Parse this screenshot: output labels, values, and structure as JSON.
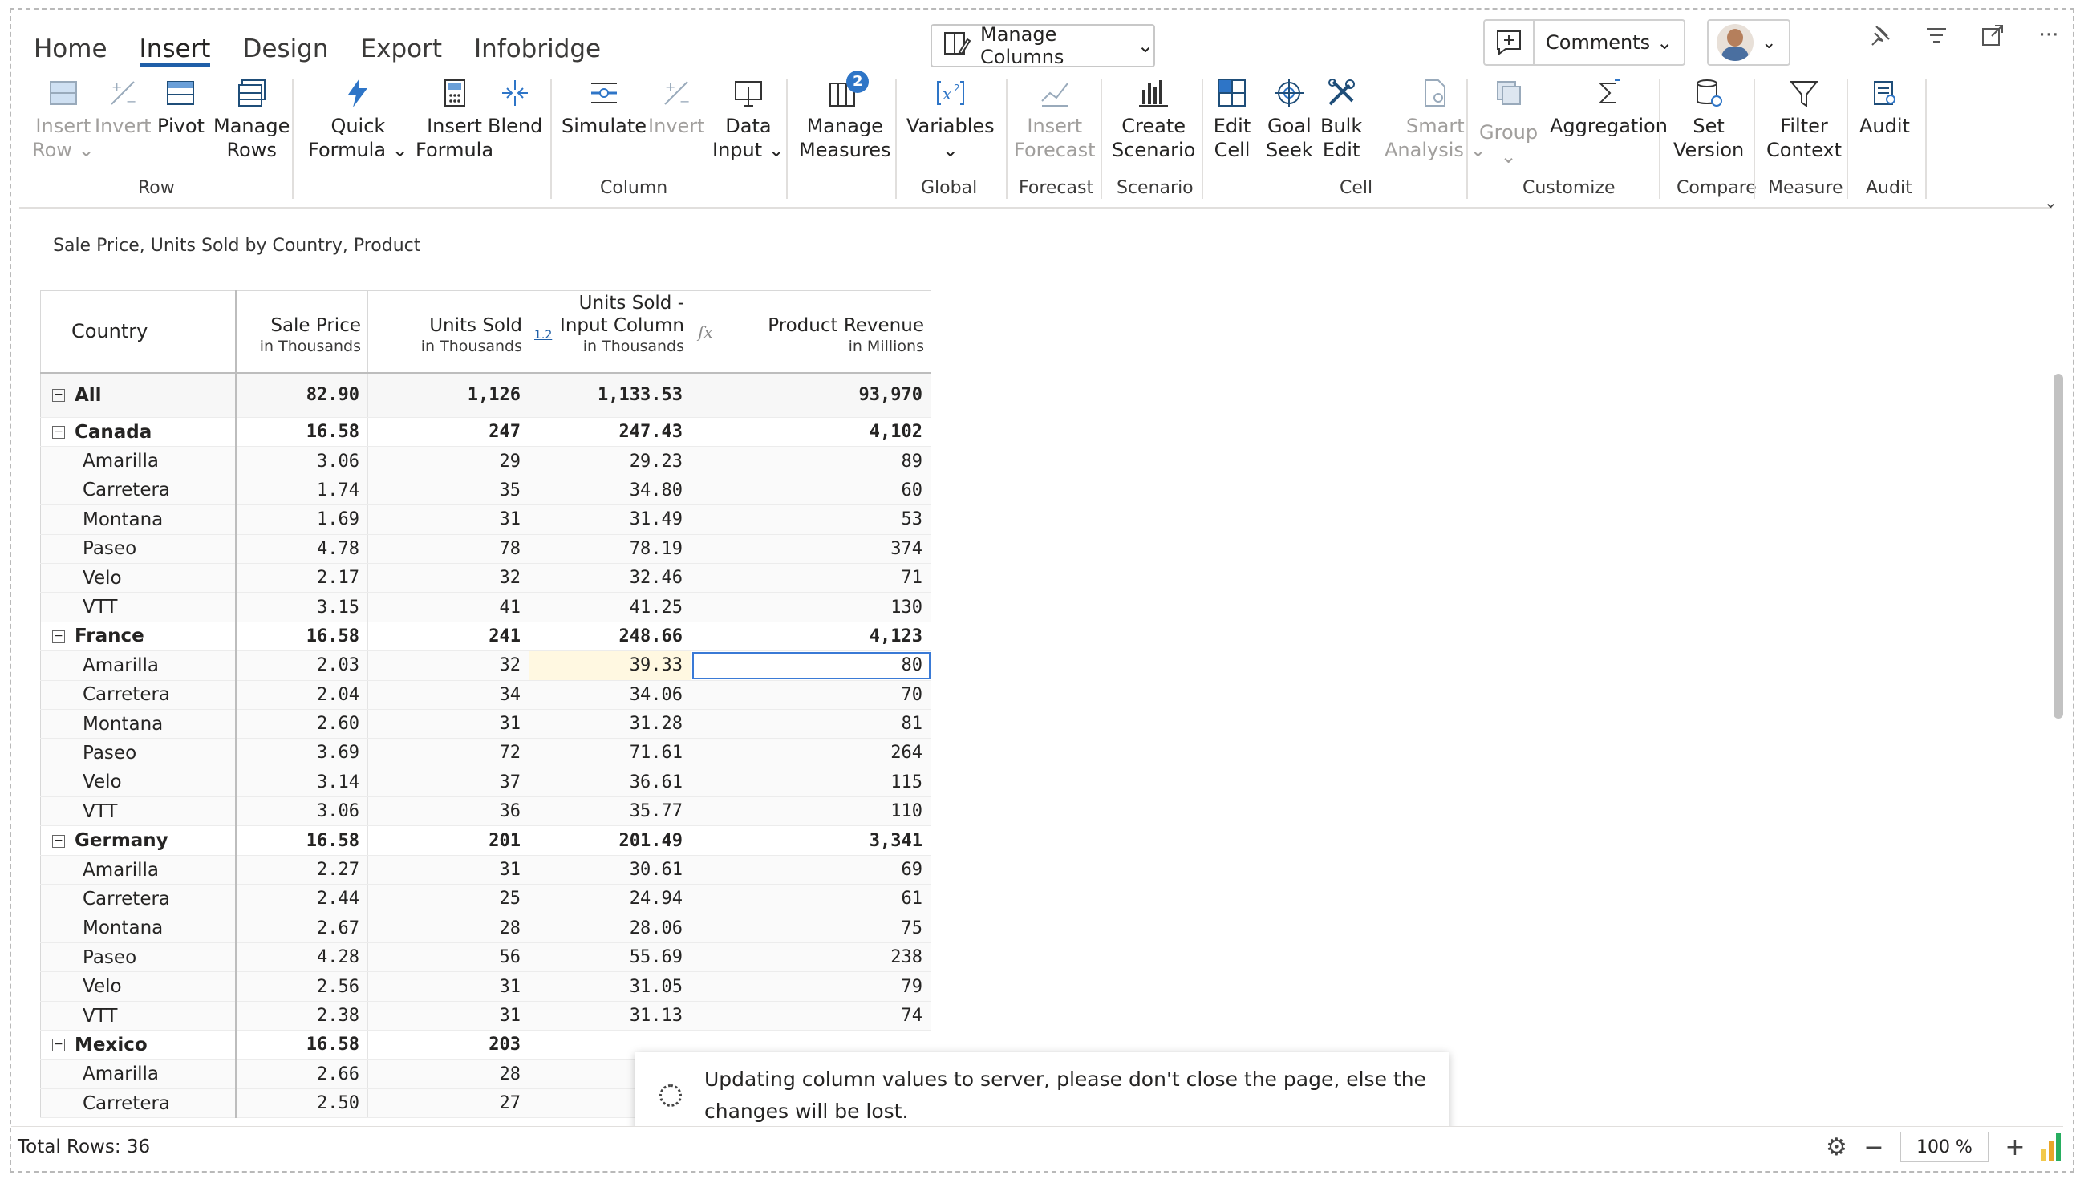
{
  "tabs": [
    {
      "label": "Home",
      "active": false
    },
    {
      "label": "Insert",
      "active": true
    },
    {
      "label": "Design",
      "active": false
    },
    {
      "label": "Export",
      "active": false
    },
    {
      "label": "Infobridge",
      "active": false
    }
  ],
  "manage_columns_label": "Manage Columns",
  "comments_label": "Comments",
  "ribbon": {
    "row": {
      "insert_row": "Insert",
      "insert_row_2": "Row",
      "invert": "Invert",
      "pivot": "Pivot",
      "manage": "Manage",
      "rows": "Rows",
      "label": "Row"
    },
    "column": {
      "quick": "Quick",
      "formula": "Formula",
      "insert": "Insert",
      "formula2": "Formula",
      "blend": "Blend",
      "simulate": "Simulate",
      "invert": "Invert",
      "data": "Data",
      "input": "Input",
      "label": "Column"
    },
    "measures": {
      "manage": "Manage",
      "measures": "Measures",
      "badge": "2"
    },
    "global": {
      "variables": "Variables",
      "label": "Global"
    },
    "forecast": {
      "insert": "Insert",
      "forecast": "Forecast",
      "label": "Forecast"
    },
    "scenario": {
      "create": "Create",
      "scenario": "Scenario",
      "label": "Scenario"
    },
    "cell": {
      "edit": "Edit",
      "cell": "Cell",
      "goal": "Goal",
      "seek": "Seek",
      "bulk": "Bulk",
      "edit2": "Edit",
      "smart": "Smart",
      "analysis": "Analysis",
      "label": "Cell"
    },
    "customize": {
      "group": "Group",
      "aggregation": "Aggregation",
      "label": "Customize"
    },
    "compare": {
      "set": "Set",
      "version": "Version",
      "label": "Compare"
    },
    "measure": {
      "filter": "Filter",
      "context": "Context",
      "label": "Measure"
    },
    "audit": {
      "audit": "Audit",
      "label": "Audit"
    }
  },
  "subtitle": "Sale Price, Units Sold by Country, Product",
  "table": {
    "headers": {
      "country": "Country",
      "sale_price": "Sale Price",
      "sale_price_unit": "in Thousands",
      "units_sold": "Units Sold",
      "units_sold_unit": "in Thousands",
      "units_input_1": "Units Sold -",
      "units_input_2": "Input Column",
      "units_input_unit": "in Thousands",
      "revenue": "Product Revenue",
      "revenue_unit": "in Millions",
      "badge": "1.2",
      "fx": "fx"
    },
    "rows": [
      {
        "type": "total",
        "name": "All",
        "v": [
          "82.90",
          "1,126",
          "1,133.53",
          "93,970"
        ]
      },
      {
        "type": "group",
        "name": "Canada",
        "v": [
          "16.58",
          "247",
          "247.43",
          "4,102"
        ]
      },
      {
        "type": "child",
        "name": "Amarilla",
        "v": [
          "3.06",
          "29",
          "29.23",
          "89"
        ]
      },
      {
        "type": "child",
        "name": "Carretera",
        "v": [
          "1.74",
          "35",
          "34.80",
          "60"
        ]
      },
      {
        "type": "child",
        "name": "Montana",
        "v": [
          "1.69",
          "31",
          "31.49",
          "53"
        ]
      },
      {
        "type": "child",
        "name": "Paseo",
        "v": [
          "4.78",
          "78",
          "78.19",
          "374"
        ]
      },
      {
        "type": "child",
        "name": "Velo",
        "v": [
          "2.17",
          "32",
          "32.46",
          "71"
        ]
      },
      {
        "type": "child",
        "name": "VTT",
        "v": [
          "3.15",
          "41",
          "41.25",
          "130"
        ]
      },
      {
        "type": "group",
        "name": "France",
        "v": [
          "16.58",
          "241",
          "248.66",
          "4,123"
        ]
      },
      {
        "type": "child",
        "name": "Amarilla",
        "v": [
          "2.03",
          "32",
          "39.33",
          "80"
        ],
        "edited": true
      },
      {
        "type": "child",
        "name": "Carretera",
        "v": [
          "2.04",
          "34",
          "34.06",
          "70"
        ]
      },
      {
        "type": "child",
        "name": "Montana",
        "v": [
          "2.60",
          "31",
          "31.28",
          "81"
        ]
      },
      {
        "type": "child",
        "name": "Paseo",
        "v": [
          "3.69",
          "72",
          "71.61",
          "264"
        ]
      },
      {
        "type": "child",
        "name": "Velo",
        "v": [
          "3.14",
          "37",
          "36.61",
          "115"
        ]
      },
      {
        "type": "child",
        "name": "VTT",
        "v": [
          "3.06",
          "36",
          "35.77",
          "110"
        ]
      },
      {
        "type": "group",
        "name": "Germany",
        "v": [
          "16.58",
          "201",
          "201.49",
          "3,341"
        ]
      },
      {
        "type": "child",
        "name": "Amarilla",
        "v": [
          "2.27",
          "31",
          "30.61",
          "69"
        ]
      },
      {
        "type": "child",
        "name": "Carretera",
        "v": [
          "2.44",
          "25",
          "24.94",
          "61"
        ]
      },
      {
        "type": "child",
        "name": "Montana",
        "v": [
          "2.67",
          "28",
          "28.06",
          "75"
        ]
      },
      {
        "type": "child",
        "name": "Paseo",
        "v": [
          "4.28",
          "56",
          "55.69",
          "238"
        ]
      },
      {
        "type": "child",
        "name": "Velo",
        "v": [
          "2.56",
          "31",
          "31.05",
          "79"
        ]
      },
      {
        "type": "child",
        "name": "VTT",
        "v": [
          "2.38",
          "31",
          "31.13",
          "74"
        ]
      },
      {
        "type": "group",
        "name": "Mexico",
        "v": [
          "16.58",
          "203",
          "",
          ""
        ]
      },
      {
        "type": "child",
        "name": "Amarilla",
        "v": [
          "2.66",
          "28",
          "",
          ""
        ]
      },
      {
        "type": "child",
        "name": "Carretera",
        "v": [
          "2.50",
          "27",
          "",
          ""
        ]
      }
    ]
  },
  "toast": "Updating column values to server, please don't close the page, else the changes will be lost.",
  "footer": {
    "total_rows": "Total Rows: 36",
    "zoom": "100 %"
  },
  "colors": {
    "accent": "#1f5fa8",
    "edited_cell": "#fff8e1",
    "selection": "#3a7ad6"
  }
}
